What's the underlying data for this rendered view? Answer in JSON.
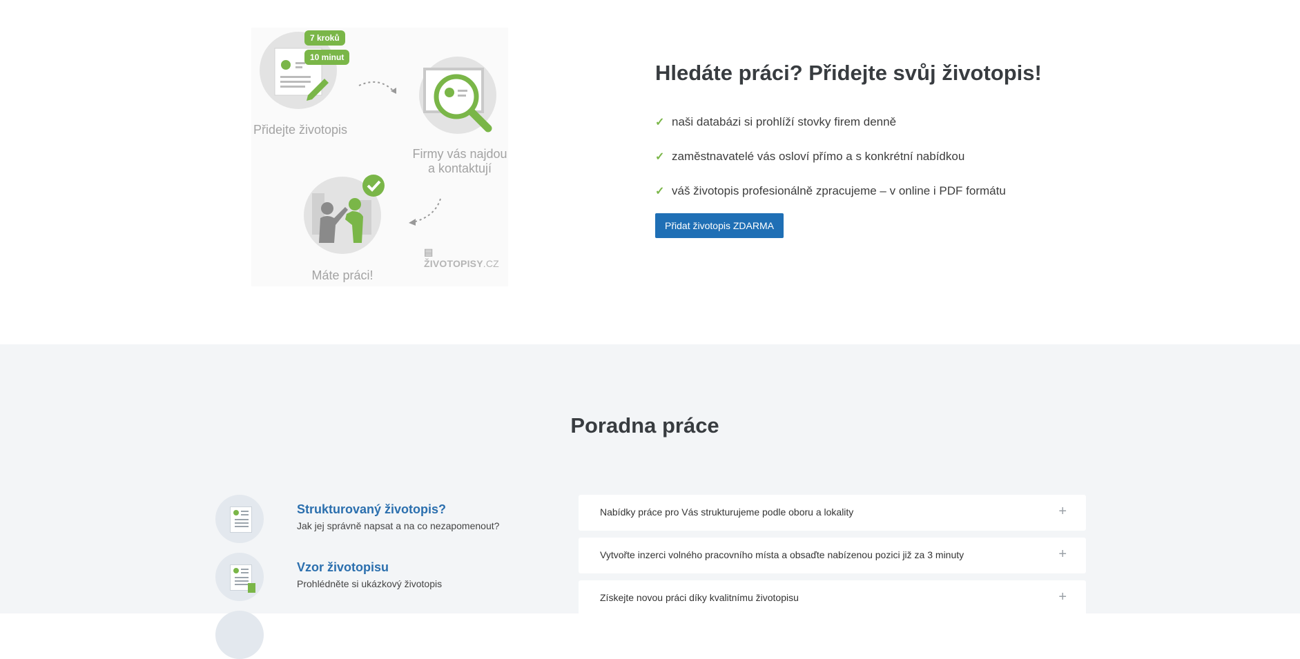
{
  "illustration": {
    "badge_steps": "7 kroků",
    "badge_minutes": "10 minut",
    "step1_label": "Přidejte životopis",
    "step2_label_line1": "Firmy vás najdou",
    "step2_label_line2": "a kontaktují",
    "step3_label": "Máte práci!",
    "brand_bold": "ŽIVOTOPISY",
    "brand_suffix": ".CZ"
  },
  "promo": {
    "title": "Hledáte práci? Přidejte svůj životopis!",
    "benefits": [
      "naši databázi si prohlíží stovky firem denně",
      "zaměstnavatelé vás osloví přímo a s konkrétní nabídkou",
      "váš životopis profesionálně zpracujeme – v online i PDF formátu"
    ],
    "cta_label": "Přidat životopis ZDARMA"
  },
  "advice": {
    "title": "Poradna práce",
    "guides": [
      {
        "title": "Strukturovaný životopis?",
        "subtitle": "Jak jej správně napsat a na co nezapomenout?"
      },
      {
        "title": "Vzor životopisu",
        "subtitle": "Prohlédněte si ukázkový životopis"
      }
    ],
    "faq": [
      "Nabídky práce pro Vás strukturujeme podle oboru a lokality",
      "Vytvořte inzerci volného pracovního místa a obsaďte nabízenou pozici již za 3 minuty",
      "Získejte novou práci díky kvalitnímu životopisu"
    ]
  },
  "colors": {
    "accent_green": "#7ab648",
    "primary_blue": "#1f6fb5",
    "link_blue": "#2b6fae"
  }
}
